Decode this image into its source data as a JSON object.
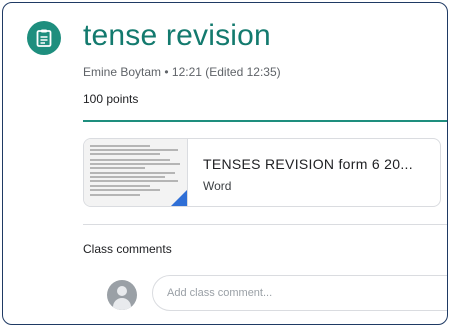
{
  "post": {
    "icon": "assignment-icon",
    "title": "tense revision",
    "meta": "Emine Boytam • 12:21 (Edited 12:35)",
    "points": "100 points",
    "accent_color": "#1e8e7e"
  },
  "attachment": {
    "title": "TENSES REVISION form 6 20...",
    "type": "Word",
    "thumbnail_icon": "word-document-thumbnail"
  },
  "comments": {
    "label": "Class comments",
    "input_placeholder": "Add class comment...",
    "avatar_icon": "default-avatar-icon"
  }
}
